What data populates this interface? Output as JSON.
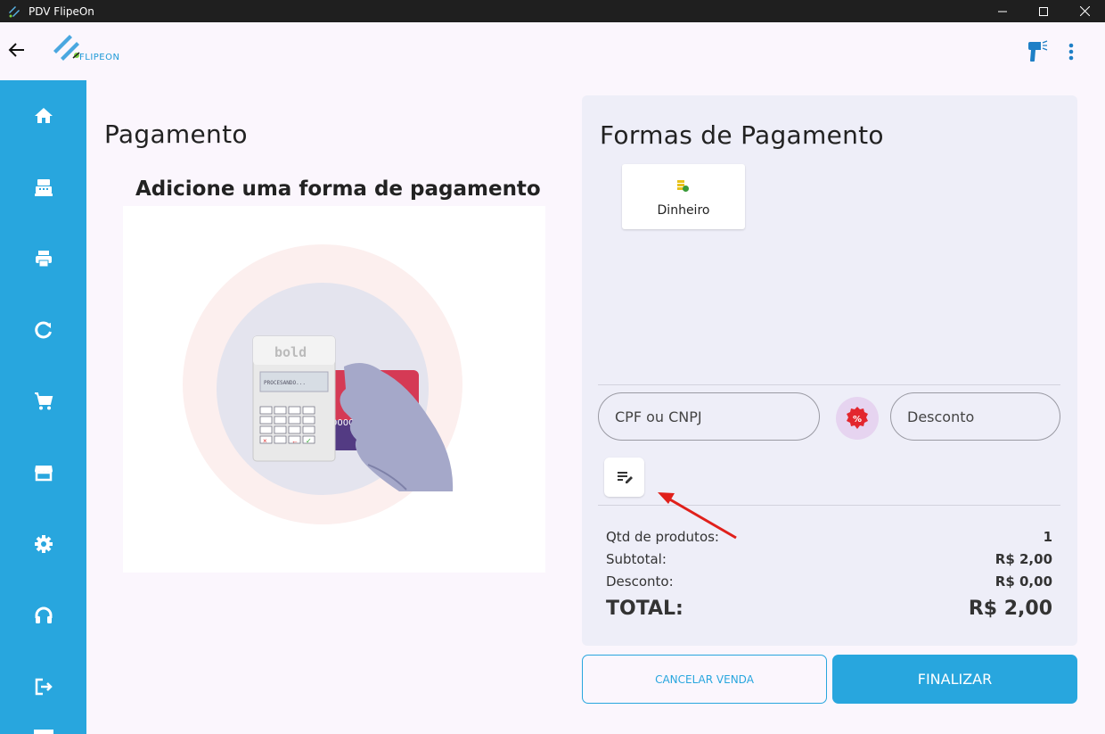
{
  "window": {
    "title": "PDV FlipeOn",
    "controls": [
      "minimize-icon",
      "maximize-icon",
      "close-icon"
    ]
  },
  "header": {
    "brand": "FLIPEON",
    "back_icon": "arrow-left-icon",
    "actions": [
      "barcode-scanner-icon",
      "more-vert-icon"
    ]
  },
  "sidebar": {
    "items": [
      {
        "icon": "home-icon"
      },
      {
        "icon": "cash-register-icon"
      },
      {
        "icon": "printer-icon"
      },
      {
        "icon": "refresh-icon"
      },
      {
        "icon": "cart-icon"
      },
      {
        "icon": "store-icon"
      },
      {
        "icon": "settings-icon"
      },
      {
        "icon": "headset-icon"
      },
      {
        "icon": "logout-icon"
      }
    ]
  },
  "main": {
    "title": "Pagamento",
    "heading": "Adicione uma forma de pagamento",
    "illustration": {
      "terminal_brand": "bold",
      "terminal_screen": "PROCESANDO...",
      "card_text": "0000"
    }
  },
  "payment_panel": {
    "title": "Formas de Pagamento",
    "methods": [
      {
        "label": "Dinheiro",
        "icon": "cash-coins-icon"
      }
    ],
    "cpf_placeholder": "CPF ou CNPJ",
    "discount_placeholder": "Desconto",
    "discount_icon": "percent-badge-icon",
    "note_icon": "edit-note-icon",
    "summary": {
      "qty_label": "Qtd de produtos:",
      "qty_value": "1",
      "subtotal_label": "Subtotal:",
      "subtotal_value": "R$ 2,00",
      "discount_label": "Desconto:",
      "discount_value": "R$ 0,00",
      "total_label": "TOTAL:",
      "total_value": "R$ 2,00"
    }
  },
  "actions": {
    "cancel_label": "CANCELAR VENDA",
    "finalize_label": "FINALIZAR"
  },
  "colors": {
    "primary": "#28a6de",
    "panel": "#eeeef8",
    "background": "#fbf6fd",
    "annotation_arrow": "#e0201b",
    "discount_badge": "#e3262e"
  }
}
